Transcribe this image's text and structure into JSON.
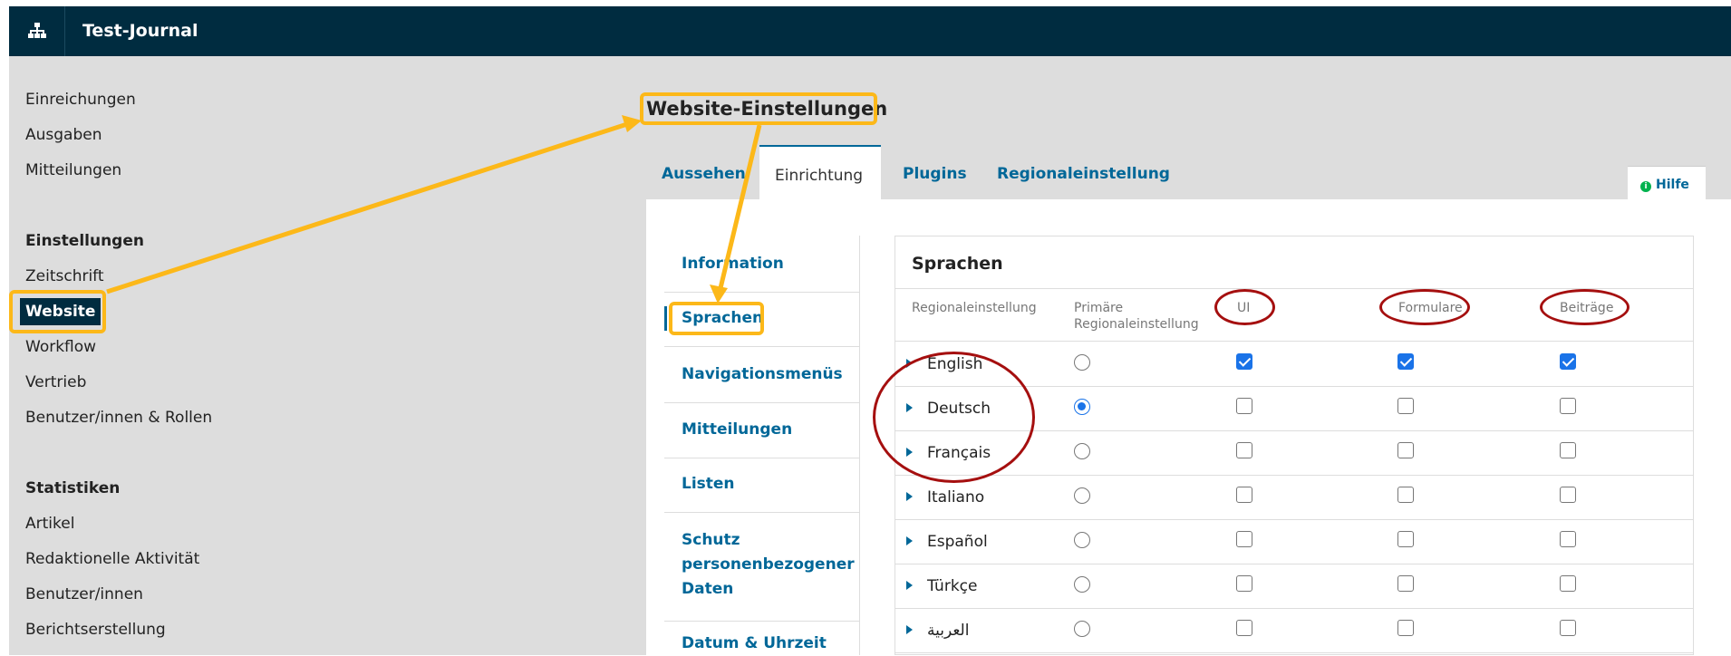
{
  "header": {
    "journal_name": "Test-Journal"
  },
  "sidebar": {
    "items": [
      "Einreichungen",
      "Ausgaben",
      "Mitteilungen"
    ],
    "settings_heading": "Einstellungen",
    "settings_items": [
      "Zeitschrift",
      "Website",
      "Workflow",
      "Vertrieb",
      "Benutzer/innen & Rollen"
    ],
    "stats_heading": "Statistiken",
    "stats_items": [
      "Artikel",
      "Redaktionelle Aktivität",
      "Benutzer/innen",
      "Berichtserstellung"
    ]
  },
  "page": {
    "title": "Website-Einstellungen",
    "tabs": [
      "Aussehen",
      "Einrichtung",
      "Plugins",
      "Regionaleinstellung"
    ],
    "help_label": "Hilfe"
  },
  "subnav": {
    "items": [
      "Information",
      "Sprachen",
      "Navigationsmenüs",
      "Mitteilungen",
      "Listen",
      "Schutz personenbezogener Daten",
      "Datum & Uhrzeit"
    ]
  },
  "languages": {
    "title": "Sprachen",
    "headers": {
      "locale": "Regionaleinstellung",
      "primary": "Primäre Regionaleinstellung",
      "ui": "UI",
      "forms": "Formulare",
      "submissions": "Beiträge"
    },
    "rows": [
      {
        "name": "English",
        "primary": false,
        "ui": true,
        "forms": true,
        "submissions": true
      },
      {
        "name": "Deutsch",
        "primary": true,
        "ui": false,
        "forms": false,
        "submissions": false
      },
      {
        "name": "Français",
        "primary": false,
        "ui": false,
        "forms": false,
        "submissions": false
      },
      {
        "name": "Italiano",
        "primary": false,
        "ui": false,
        "forms": false,
        "submissions": false
      },
      {
        "name": "Español",
        "primary": false,
        "ui": false,
        "forms": false,
        "submissions": false
      },
      {
        "name": "Türkçe",
        "primary": false,
        "ui": false,
        "forms": false,
        "submissions": false
      },
      {
        "name": "العربية",
        "primary": false,
        "ui": false,
        "forms": false,
        "submissions": false
      }
    ]
  },
  "colors": {
    "topbar": "#002c40",
    "link": "#006798",
    "highlight": "#fcb819",
    "annotation_red": "#a50f0f",
    "checkbox": "#1a73e8"
  }
}
